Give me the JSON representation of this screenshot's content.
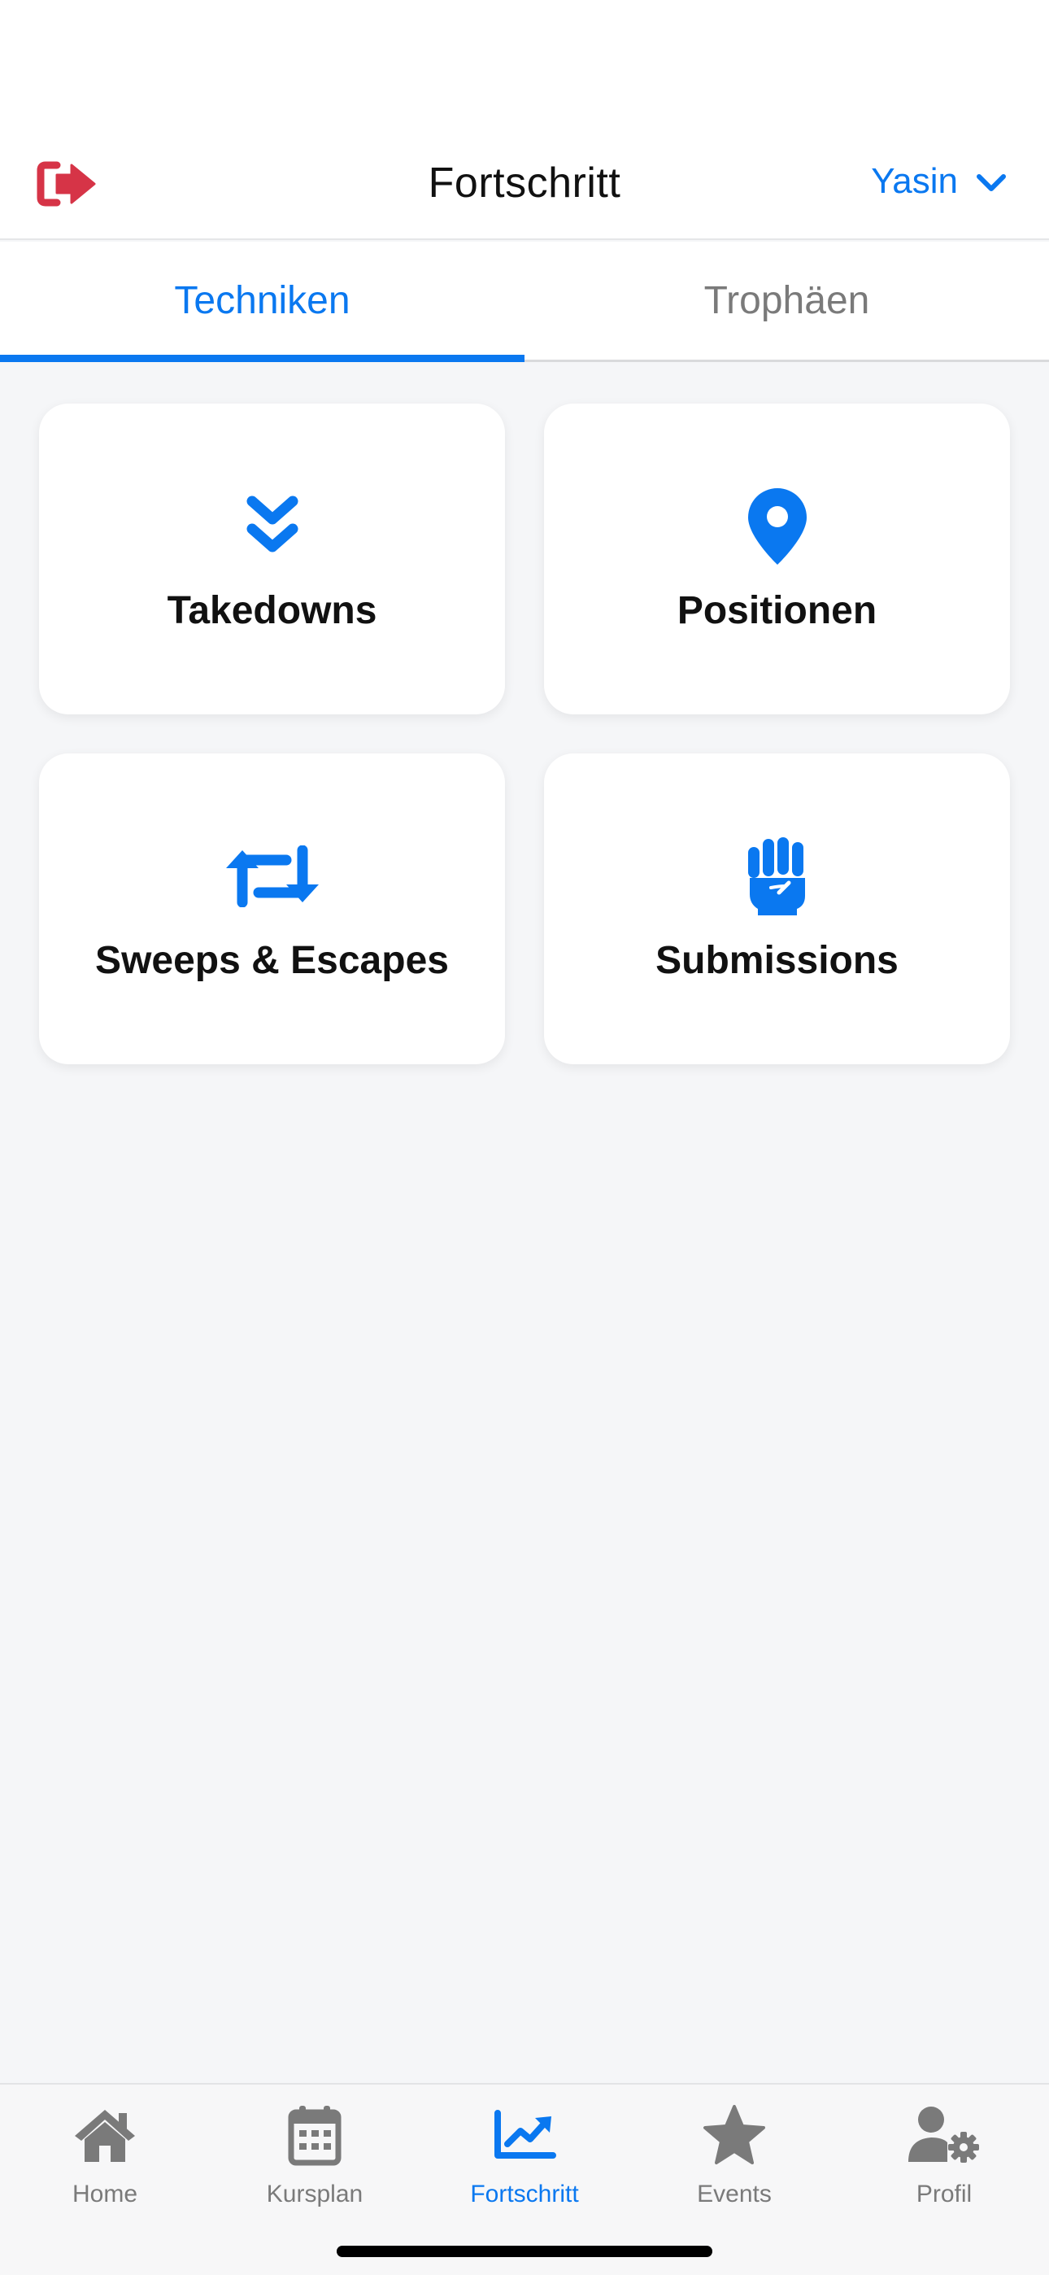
{
  "header": {
    "title": "Fortschritt",
    "user_name": "Yasin",
    "logout_icon": "sign-out-icon",
    "user_dropdown_icon": "chevron-down-icon"
  },
  "tabs": [
    {
      "label": "Techniken",
      "active": true
    },
    {
      "label": "Trophäen",
      "active": false
    }
  ],
  "categories": [
    {
      "label": "Takedowns",
      "icon": "angles-down-icon"
    },
    {
      "label": "Positionen",
      "icon": "location-pin-icon"
    },
    {
      "label": "Sweeps & Escapes",
      "icon": "retweet-icon"
    },
    {
      "label": "Submissions",
      "icon": "fist-icon"
    }
  ],
  "bottom_nav": [
    {
      "label": "Home",
      "icon": "house-icon",
      "active": false
    },
    {
      "label": "Kursplan",
      "icon": "calendar-icon",
      "active": false
    },
    {
      "label": "Fortschritt",
      "icon": "chart-line-icon",
      "active": true
    },
    {
      "label": "Events",
      "icon": "star-icon",
      "active": false
    },
    {
      "label": "Profil",
      "icon": "user-gear-icon",
      "active": false
    }
  ],
  "colors": {
    "accent": "#0a78f0",
    "logout": "#d63447",
    "inactive": "#7a7a7a"
  }
}
